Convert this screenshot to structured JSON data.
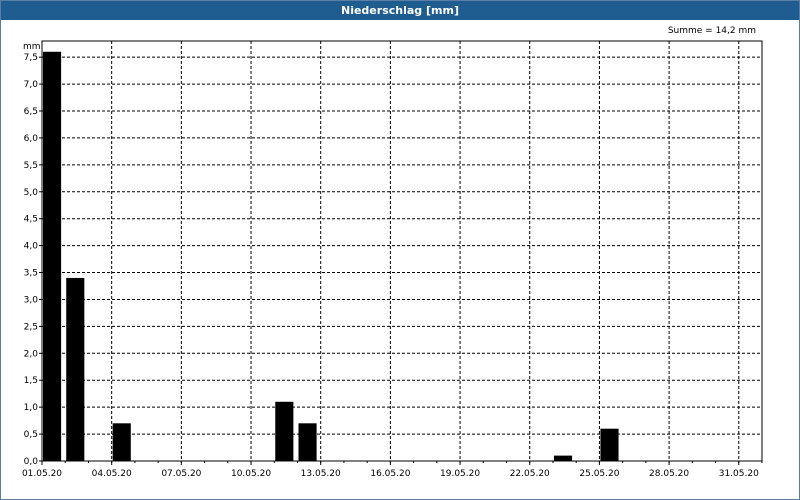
{
  "window": {
    "title": "Niederschlag [mm]"
  },
  "chart_data": {
    "type": "bar",
    "title": "Niederschlag [mm]",
    "ylabel": "mm",
    "xlabel": "",
    "annotation": "Summe = 14,2 mm",
    "ylim": [
      0,
      7.8
    ],
    "yticks": [
      0,
      0.5,
      1.0,
      1.5,
      2.0,
      2.5,
      3.0,
      3.5,
      4.0,
      4.5,
      5.0,
      5.5,
      6.0,
      6.5,
      7.0,
      7.5
    ],
    "ytick_labels": [
      "0,0",
      "0,5",
      "1,0",
      "1,5",
      "2,0",
      "2,5",
      "3,0",
      "3,5",
      "4,0",
      "4,5",
      "5,0",
      "5,5",
      "6,0",
      "6,5",
      "7,0",
      "7,5"
    ],
    "xticks": [
      "01.05.20",
      "04.05.20",
      "07.05.20",
      "10.05.20",
      "13.05.20",
      "16.05.20",
      "19.05.20",
      "22.05.20",
      "25.05.20",
      "28.05.20",
      "31.05.20"
    ],
    "grid": true,
    "bar_color": "#000000",
    "categories": [
      "01.05.20",
      "02.05.20",
      "03.05.20",
      "04.05.20",
      "05.05.20",
      "06.05.20",
      "07.05.20",
      "08.05.20",
      "09.05.20",
      "10.05.20",
      "11.05.20",
      "12.05.20",
      "13.05.20",
      "14.05.20",
      "15.05.20",
      "16.05.20",
      "17.05.20",
      "18.05.20",
      "19.05.20",
      "20.05.20",
      "21.05.20",
      "22.05.20",
      "23.05.20",
      "24.05.20",
      "25.05.20",
      "26.05.20",
      "27.05.20",
      "28.05.20",
      "29.05.20",
      "30.05.20",
      "31.05.20"
    ],
    "values": [
      7.6,
      3.4,
      0,
      0.7,
      0,
      0,
      0,
      0,
      0,
      0,
      1.1,
      0.7,
      0,
      0,
      0,
      0,
      0,
      0,
      0,
      0,
      0,
      0,
      0.1,
      0,
      0.6,
      0,
      0,
      0,
      0,
      0,
      0
    ]
  }
}
